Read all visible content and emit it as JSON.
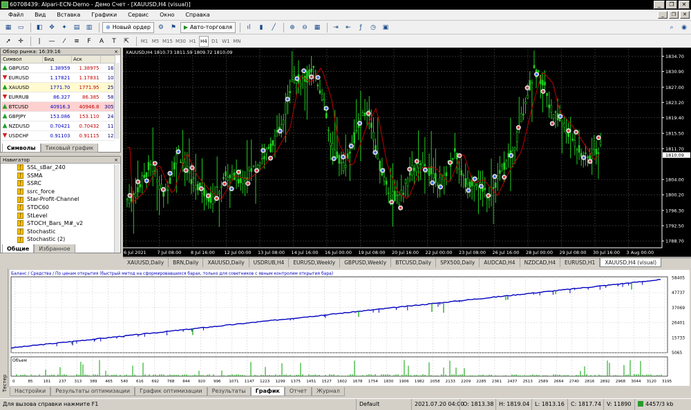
{
  "window": {
    "title": "60708439: Alpari-ECN-Demo - Демо Счет - [XAUUSD,H4 (visual)]"
  },
  "menu": [
    "Файл",
    "Вид",
    "Вставка",
    "Графики",
    "Сервис",
    "Окно",
    "Справка"
  ],
  "toolbar": {
    "new_order": "Новый ордер",
    "autotrading": "Авто-торговля",
    "timeframes": [
      "M1",
      "M5",
      "M15",
      "M30",
      "H1",
      "H4",
      "D1",
      "W1",
      "MN"
    ],
    "active_tf": "H4"
  },
  "market_watch": {
    "title": "Обзор рынка: 16:39:16",
    "headers": [
      "Символ",
      "Бид",
      "Аск",
      ""
    ],
    "rows": [
      {
        "symbol": "GBPUSD",
        "bid": "1.38959",
        "ask": "1.38975",
        "spread": "16",
        "dir": "up"
      },
      {
        "symbol": "EURUSD",
        "bid": "1.17821",
        "ask": "1.17831",
        "spread": "10",
        "dir": "dn"
      },
      {
        "symbol": "XAUUSD",
        "bid": "1771.70",
        "ask": "1771.95",
        "spread": "25",
        "dir": "up"
      },
      {
        "symbol": "EURRUB",
        "bid": "86.327",
        "ask": "86.385",
        "spread": "58",
        "dir": "dn"
      },
      {
        "symbol": "BTCUSD",
        "bid": "40916.3",
        "ask": "40946.8",
        "spread": "305",
        "dir": "up"
      },
      {
        "symbol": "GBPJPY",
        "bid": "153.086",
        "ask": "153.110",
        "spread": "24",
        "dir": "up"
      },
      {
        "symbol": "NZDUSD",
        "bid": "0.70421",
        "ask": "0.70432",
        "spread": "11",
        "dir": "up"
      },
      {
        "symbol": "USDCHF",
        "bid": "0.91103",
        "ask": "0.91115",
        "spread": "12",
        "dir": "dn"
      }
    ],
    "tabs": [
      "Символы",
      "Тиковый график"
    ]
  },
  "navigator": {
    "title": "Навигатор",
    "items": [
      "SSL_sBar_240",
      "SSMA",
      "SSRC",
      "ssrc_force",
      "Star-Profit-Channel",
      "STDC60",
      "StLevel",
      "STOCH_Bars_M#_v2",
      "Stochastic",
      "Stochastic (2)"
    ],
    "tabs": [
      "Общие",
      "Избранное"
    ]
  },
  "chart": {
    "title": "XAUUSD,H4  1810.73 1811.59 1809.72 1810.09",
    "price_labels": [
      "1834.70",
      "1830.90",
      "1827.00",
      "1823.20",
      "1819.40",
      "1815.50",
      "1811.70",
      "1804.00",
      "1800.20",
      "1796.30",
      "1792.50",
      "1788.70"
    ],
    "current_price": "1810.09",
    "date_labels": [
      "6 Jul 2021",
      "7 Jul 08:00",
      "8 Jul 16:00",
      "12 Jul 00:00",
      "13 Jul 08:00",
      "14 Jul 16:00",
      "16 Jul 00:00",
      "19 Jul 08:00",
      "20 Jul 16:00",
      "22 Jul 00:00",
      "23 Jul 08:00",
      "26 Jul 16:00",
      "28 Jul 00:00",
      "29 Jul 08:00",
      "30 Jul 16:00",
      "3 Aug 00:00"
    ],
    "colors": {
      "bull": "#1fd01f",
      "bear": "#1fd01f",
      "ma": "#c00000",
      "bg": "#000000"
    }
  },
  "chart_tabs": [
    "XAUUSD,Daily",
    "BRN,Daily",
    "XAUUSD,Daily",
    "USDRUB,H4",
    "EURUSD,Weekly",
    "GBPUSD,Weekly",
    "BTCUSD,Daily",
    "SPX500,Daily",
    "AUDCAD,H4",
    "NZDCAD,H4",
    "EURUSD,H1",
    "XAUUSD,H4 (visual)"
  ],
  "active_chart_tab": 11,
  "tester": {
    "side_label": "Тестер",
    "legend": "Баланс / Средства / По ценам открытия (быстрый метод на сформировавшихся барах, только для советников с явным контролем открытия бара)",
    "volume_label": "Объем",
    "y_labels": [
      "58405",
      "47737",
      "37069",
      "26401",
      "15733",
      "5065"
    ],
    "x_labels": [
      "0",
      "85",
      "161",
      "237",
      "313",
      "389",
      "465",
      "540",
      "616",
      "692",
      "768",
      "844",
      "920",
      "996",
      "1071",
      "1147",
      "1223",
      "1299",
      "1375",
      "1451",
      "1527",
      "1602",
      "1678",
      "1754",
      "1830",
      "1906",
      "1982",
      "2058",
      "2133",
      "2209",
      "2285",
      "2361",
      "2437",
      "2513",
      "2589",
      "2664",
      "2740",
      "2816",
      "2892",
      "2968",
      "3044",
      "3120",
      "3195"
    ],
    "tabs": [
      "Настройки",
      "Результаты оптимизации",
      "График оптимизации",
      "Результаты",
      "График",
      "Отчет",
      "Журнал"
    ],
    "active_tab": "График",
    "colors": {
      "balance": "#0000c0",
      "equity": "#00a000"
    }
  },
  "status": {
    "help": "Для вызова справки нажмите F1",
    "profile": "Default",
    "datetime": "2021.07.20 04:00",
    "open": "O: 1813.38",
    "high": "H: 1819.04",
    "low": "L: 1813.16",
    "close": "C: 1817.74",
    "volume": "V: 11890",
    "traffic": "4457/3 kb"
  }
}
